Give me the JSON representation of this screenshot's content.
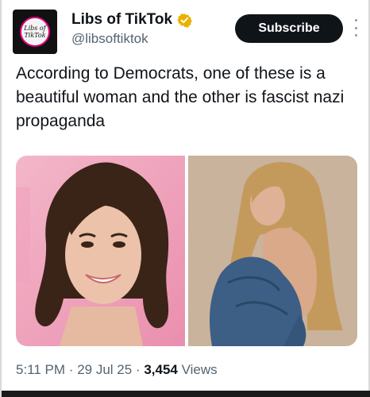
{
  "account": {
    "avatar_text_line1": "Libs of",
    "avatar_text_line2": "TikTok",
    "display_name": "Libs of TikTok",
    "handle": "@libsoftiktok",
    "verified_color": "#e8b300"
  },
  "actions": {
    "subscribe_label": "Subscribe",
    "more_icon": "more-vertical-icon"
  },
  "tweet": {
    "text": "According to Democrats, one of these is a beautiful woman and the other is fascist nazi propaganda"
  },
  "media": {
    "images": [
      {
        "name": "photo-left",
        "description_icon": "photo"
      },
      {
        "name": "photo-right",
        "description_icon": "photo"
      }
    ]
  },
  "meta": {
    "time": "5:11 PM",
    "date": "29 Jul 25",
    "views_count": "3,454",
    "views_label": "Views",
    "separator": "·"
  },
  "colors": {
    "text_primary": "#0f1419",
    "text_secondary": "#536471",
    "button_bg": "#0f1419",
    "avatar_ring": "#e3007a"
  }
}
